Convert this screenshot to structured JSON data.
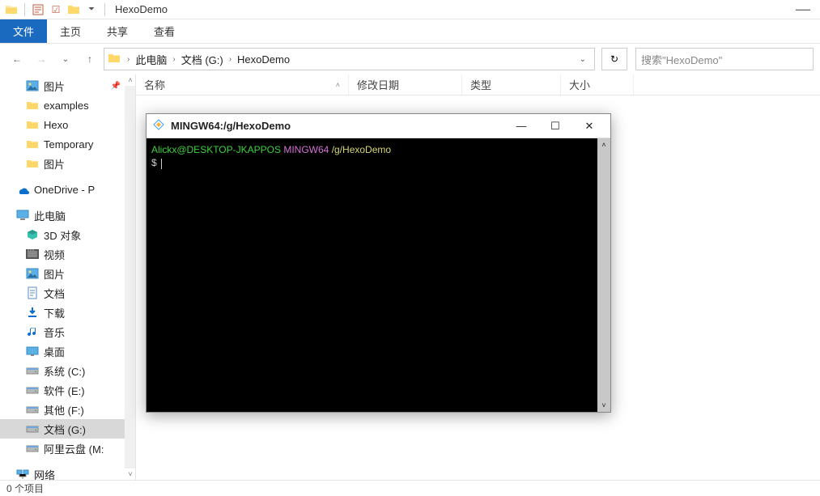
{
  "titlebar": {
    "title": "HexoDemo"
  },
  "ribbon": {
    "file": "文件",
    "tabs": [
      "主页",
      "共享",
      "查看"
    ]
  },
  "breadcrumb": {
    "segments": [
      "此电脑",
      "文档 (G:)",
      "HexoDemo"
    ]
  },
  "search": {
    "placeholder": "搜索\"HexoDemo\""
  },
  "columns": {
    "name": "名称",
    "date": "修改日期",
    "type": "类型",
    "size": "大小"
  },
  "sidebar": {
    "items": [
      {
        "label": "图片",
        "icon": "picture",
        "depth": 1,
        "pin": true
      },
      {
        "label": "examples",
        "icon": "folder",
        "depth": 1
      },
      {
        "label": "Hexo",
        "icon": "folder",
        "depth": 1
      },
      {
        "label": "Temporary",
        "icon": "folder",
        "depth": 1
      },
      {
        "label": "图片",
        "icon": "folder",
        "depth": 1
      },
      {
        "label": "OneDrive - P",
        "icon": "onedrive",
        "depth": 0,
        "gap": true
      },
      {
        "label": "此电脑",
        "icon": "pc",
        "depth": 0,
        "gap": true
      },
      {
        "label": "3D 对象",
        "icon": "3d",
        "depth": 1
      },
      {
        "label": "视频",
        "icon": "video",
        "depth": 1
      },
      {
        "label": "图片",
        "icon": "picture",
        "depth": 1
      },
      {
        "label": "文档",
        "icon": "doc",
        "depth": 1
      },
      {
        "label": "下载",
        "icon": "download",
        "depth": 1
      },
      {
        "label": "音乐",
        "icon": "music",
        "depth": 1
      },
      {
        "label": "桌面",
        "icon": "desktop",
        "depth": 1
      },
      {
        "label": "系统 (C:)",
        "icon": "drive",
        "depth": 1
      },
      {
        "label": "软件 (E:)",
        "icon": "drive",
        "depth": 1
      },
      {
        "label": "其他 (F:)",
        "icon": "drive",
        "depth": 1
      },
      {
        "label": "文档 (G:)",
        "icon": "drive",
        "depth": 1,
        "sel": true
      },
      {
        "label": "阿里云盘 (M:",
        "icon": "drive",
        "depth": 1
      },
      {
        "label": "网络",
        "icon": "network",
        "depth": 0,
        "gap": true
      }
    ]
  },
  "status": {
    "text": "0 个项目"
  },
  "terminal": {
    "title": "MINGW64:/g/HexoDemo",
    "prompt_user": "Alickx@DESKTOP-JKAPPOS",
    "prompt_env": "MINGW64",
    "prompt_path": "/g/HexoDemo",
    "prompt_symbol": "$"
  }
}
